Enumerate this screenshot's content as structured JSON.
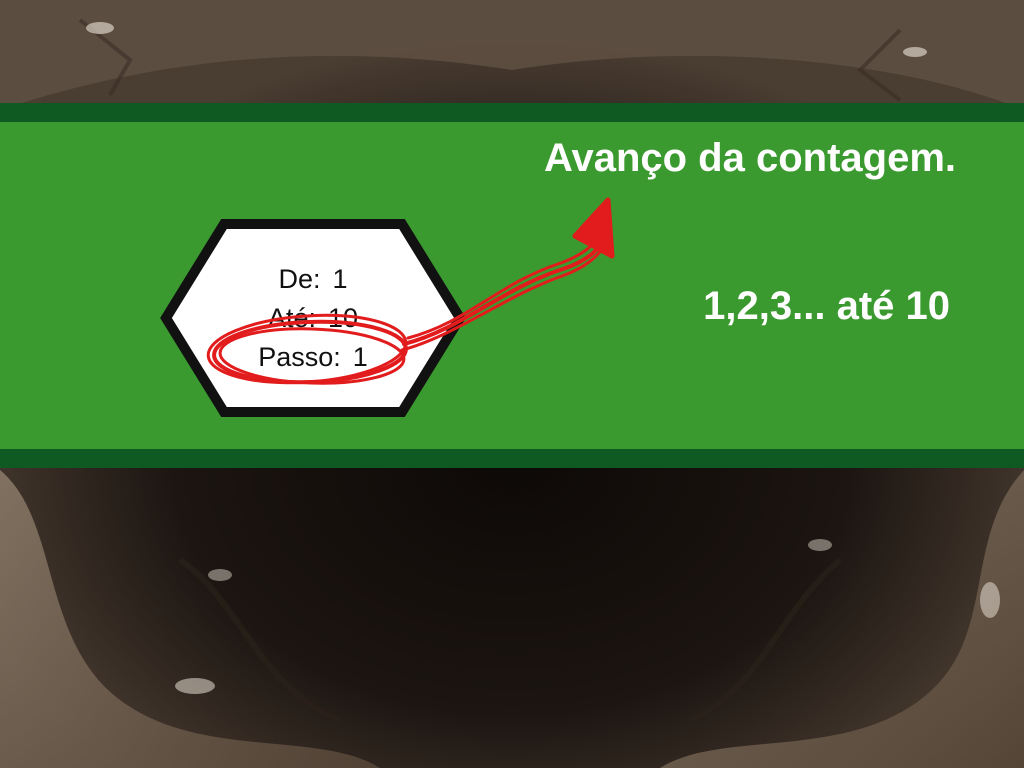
{
  "slide": {
    "title": "Avanço da contagem.",
    "sequence_text": "1,2,3... até 10"
  },
  "hexagon": {
    "de_label": "De:",
    "de_value": "1",
    "ate_label": "Até:",
    "ate_value": "10",
    "passo_label": "Passo:",
    "passo_value": "1"
  },
  "annotation": {
    "highlight_target": "Passo: 1",
    "shape": "red scribbled circle with arrow"
  },
  "colors": {
    "banner": "#3b9a2f",
    "banner_edge": "#0f5a22",
    "annotation": "#e21c1c",
    "text": "#ffffff",
    "hexagon_border": "#111111",
    "hexagon_fill": "#ffffff"
  },
  "icons": {
    "background": "cave-rock-background",
    "annotation": "red-hand-drawn-arrow-icon"
  }
}
